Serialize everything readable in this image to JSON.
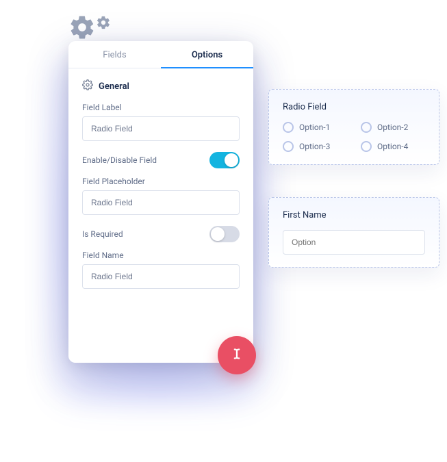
{
  "tabs": {
    "fields": "Fields",
    "options": "Options"
  },
  "section": {
    "general": "General"
  },
  "form": {
    "field_label_label": "Field Label",
    "field_label_value": "Radio Field",
    "enable_disable_label": "Enable/Disable Field",
    "enable_disable_on": true,
    "field_placeholder_label": "Field Placeholder",
    "field_placeholder_value": "Radio Field",
    "is_required_label": "Is Required",
    "is_required_on": false,
    "field_name_label": "Field Name",
    "field_name_value": "Radio Field"
  },
  "preview": {
    "radio_title": "Radio Field",
    "radio_options": [
      "Option-1",
      "Option-2",
      "Option-3",
      "Option-4"
    ],
    "firstname_title": "First Name",
    "firstname_placeholder": "Option"
  },
  "colors": {
    "accent": "#1f8fff",
    "toggle_on": "#14b4e0",
    "fab": "#e94f64"
  }
}
